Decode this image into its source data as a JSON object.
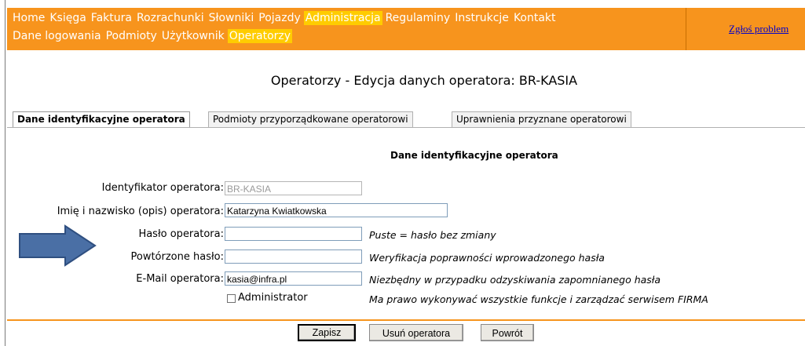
{
  "menu": {
    "row1": [
      "Home",
      "Księga",
      "Faktura",
      "Rozrachunki",
      "Słowniki",
      "Pojazdy",
      "Administracja",
      "Regulaminy",
      "Instrukcje",
      "Kontakt"
    ],
    "row2": [
      "Dane logowania",
      "Podmioty",
      "Użytkownik",
      "Operatorzy"
    ],
    "active_row1": "Administracja",
    "active_row2": "Operatorzy"
  },
  "report_link": "Zgłoś problem",
  "page_title": "Operatorzy - Edycja danych operatora: BR-KASIA",
  "tabs": [
    {
      "label": "Dane identyfikacyjne operatora",
      "active": true
    },
    {
      "label": "Podmioty przyporządkowane operatorowi",
      "active": false
    },
    {
      "label": "Uprawnienia przyznane operatorowi",
      "active": false
    }
  ],
  "form": {
    "section_title": "Dane identyfikacyjne operatora",
    "fields": {
      "id": {
        "label": "Identyfikator operatora:",
        "value": "BR-KASIA"
      },
      "name": {
        "label": "Imię i nazwisko (opis) operatora:",
        "value": "Katarzyna Kwiatkowska"
      },
      "password": {
        "label": "Hasło operatora:",
        "value": "",
        "hint": "Puste = hasło bez zmiany"
      },
      "password_repeat": {
        "label": "Powtórzone hasło:",
        "value": "",
        "hint": "Weryfikacja poprawności wprowadzonego hasła"
      },
      "email": {
        "label": "E-Mail operatora:",
        "value": "kasia@infra.pl",
        "hint": "Niezbędny w przypadku odzyskiwania zapomnianego hasła"
      }
    },
    "admin_checkbox": {
      "label": "Administrator",
      "checked": false,
      "hint": "Ma prawo wykonywać wszystkie funkcje i zarządzać serwisem FIRMA"
    }
  },
  "buttons": {
    "save": "Zapisz",
    "delete": "Usuń operatora",
    "back": "Powrót"
  },
  "colors": {
    "menu_bar": "#f7941d",
    "menu_active": "#ffcc00",
    "arrow": "#4a6fa5",
    "link": "#0000cc"
  },
  "icons": {
    "arrow": "right-arrow-icon"
  }
}
